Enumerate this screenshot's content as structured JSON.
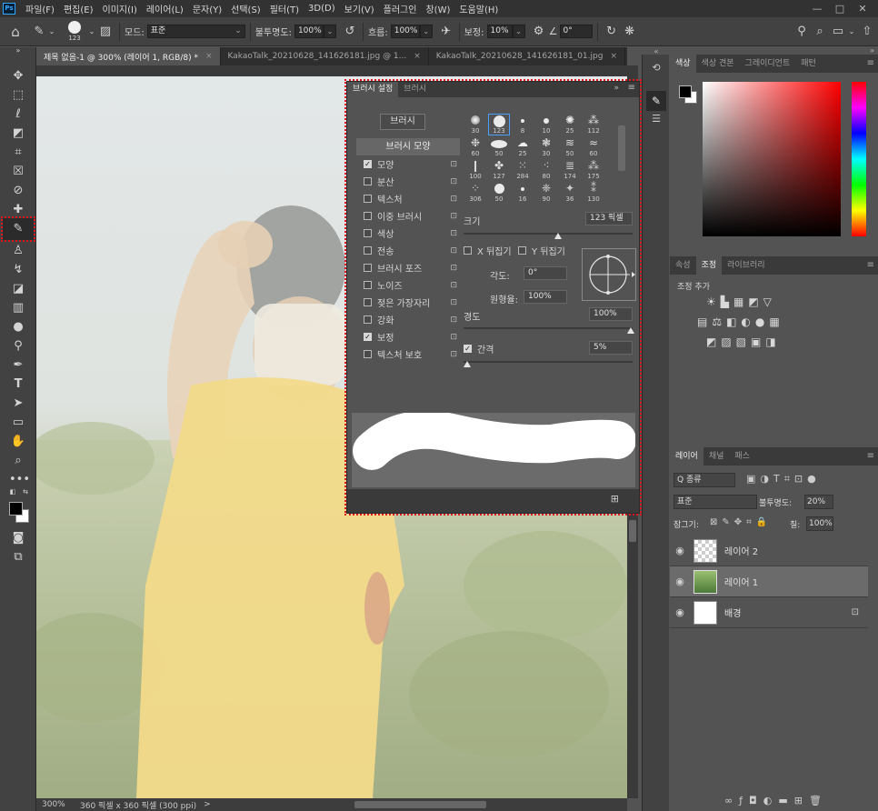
{
  "app": {
    "logo": "Ps"
  },
  "menu": [
    "파일(F)",
    "편집(E)",
    "이미지(I)",
    "레이어(L)",
    "문자(Y)",
    "선택(S)",
    "필터(T)",
    "3D(D)",
    "보기(V)",
    "플러그인",
    "창(W)",
    "도움말(H)"
  ],
  "window_controls": {
    "minimize": "—",
    "maximize": "□",
    "close": "✕"
  },
  "options": {
    "brush_size": "123",
    "mode_label": "모드:",
    "mode_value": "표준",
    "opacity_label": "불투명도:",
    "opacity_value": "100%",
    "flow_label": "흐름:",
    "flow_value": "100%",
    "smoothing_label": "보정:",
    "smoothing_value": "10%",
    "angle_value": "0°"
  },
  "tabs": [
    {
      "label": "제목 없음-1 @ 300% (레이어 1, RGB/8) *",
      "close": "×"
    },
    {
      "label": "KakaoTalk_20210628_141626181.jpg @ 1...",
      "close": "×"
    },
    {
      "label": "KakaoTalk_20210628_141626181_01.jpg",
      "close": "×"
    }
  ],
  "status": {
    "zoom": "300%",
    "doc_info": "360 픽셀 x 360 픽셀 (300 ppi)",
    "arrow": ">"
  },
  "brush_panel": {
    "tabs": [
      "브러시 설정",
      "브러시"
    ],
    "brush_button": "브러시",
    "shape_header": "브러시 모양",
    "options": [
      {
        "label": "모양",
        "checked": true
      },
      {
        "label": "분산",
        "checked": false
      },
      {
        "label": "텍스처",
        "checked": false
      },
      {
        "label": "이중 브러시",
        "checked": false
      },
      {
        "label": "색상",
        "checked": false
      },
      {
        "label": "전송",
        "checked": false
      },
      {
        "label": "브러시 포즈",
        "checked": false
      },
      {
        "label": "노이즈",
        "checked": false
      },
      {
        "label": "젖은 가장자리",
        "checked": false
      },
      {
        "label": "강화",
        "checked": false
      },
      {
        "label": "보정",
        "checked": true
      },
      {
        "label": "텍스처 보호",
        "checked": false
      }
    ],
    "tips": [
      [
        "30",
        "123",
        "8",
        "10",
        "25",
        "112"
      ],
      [
        "60",
        "50",
        "25",
        "30",
        "50",
        "60"
      ],
      [
        "100",
        "127",
        "284",
        "80",
        "174",
        "175"
      ],
      [
        "306",
        "50",
        "16",
        "90",
        "36",
        "130"
      ]
    ],
    "size_label": "크기",
    "size_value": "123 픽셀",
    "flip_x": "X 뒤집기",
    "flip_y": "Y 뒤집기",
    "angle_label": "각도:",
    "angle_value": "0°",
    "roundness_label": "원형율:",
    "roundness_value": "100%",
    "hardness_label": "경도",
    "hardness_value": "100%",
    "spacing_label": "간격",
    "spacing_value": "5%"
  },
  "color_panel": {
    "tabs": [
      "색상",
      "색상 견본",
      "그레이디언트",
      "패턴"
    ]
  },
  "adjust_panel": {
    "tabs": [
      "속성",
      "조정",
      "라이브러리"
    ],
    "title": "조정 추가"
  },
  "layers_panel": {
    "tabs": [
      "레이어",
      "채널",
      "패스"
    ],
    "filter": "Q 종류",
    "blend": "표준",
    "opacity_label": "불투명도:",
    "opacity_value": "20%",
    "lock_label": "잠그기:",
    "fill_label": "칠:",
    "fill_value": "100%",
    "layers": [
      {
        "name": "레이어 2"
      },
      {
        "name": "레이어 1"
      },
      {
        "name": "배경"
      }
    ]
  }
}
